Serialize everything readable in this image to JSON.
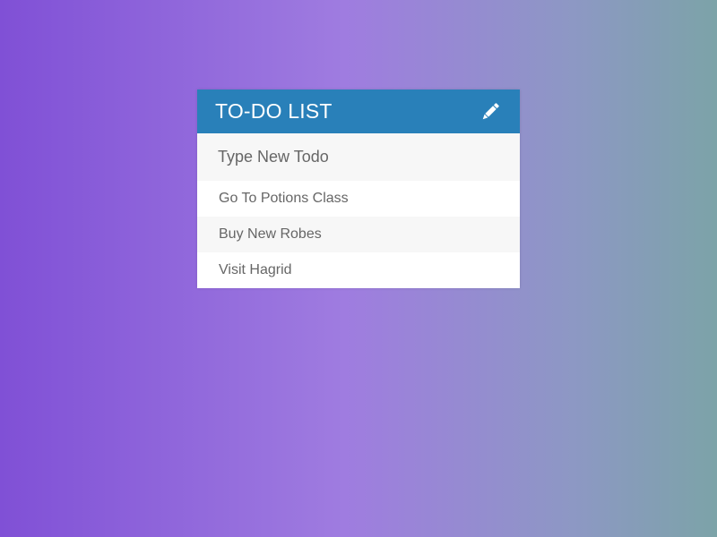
{
  "todo": {
    "title": "TO-DO LIST",
    "edit_icon": "pencil-icon",
    "input": {
      "placeholder": "Type New Todo",
      "value": ""
    },
    "items": [
      {
        "label": "Go To Potions Class"
      },
      {
        "label": "Buy New Robes"
      },
      {
        "label": "Visit Hagrid"
      }
    ]
  },
  "colors": {
    "header": "#2980b9",
    "background_gradient": [
      "#8050d6",
      "#9f7ce0",
      "#7ca3a8"
    ],
    "row_alt": "#f7f7f7",
    "text": "#666666"
  }
}
